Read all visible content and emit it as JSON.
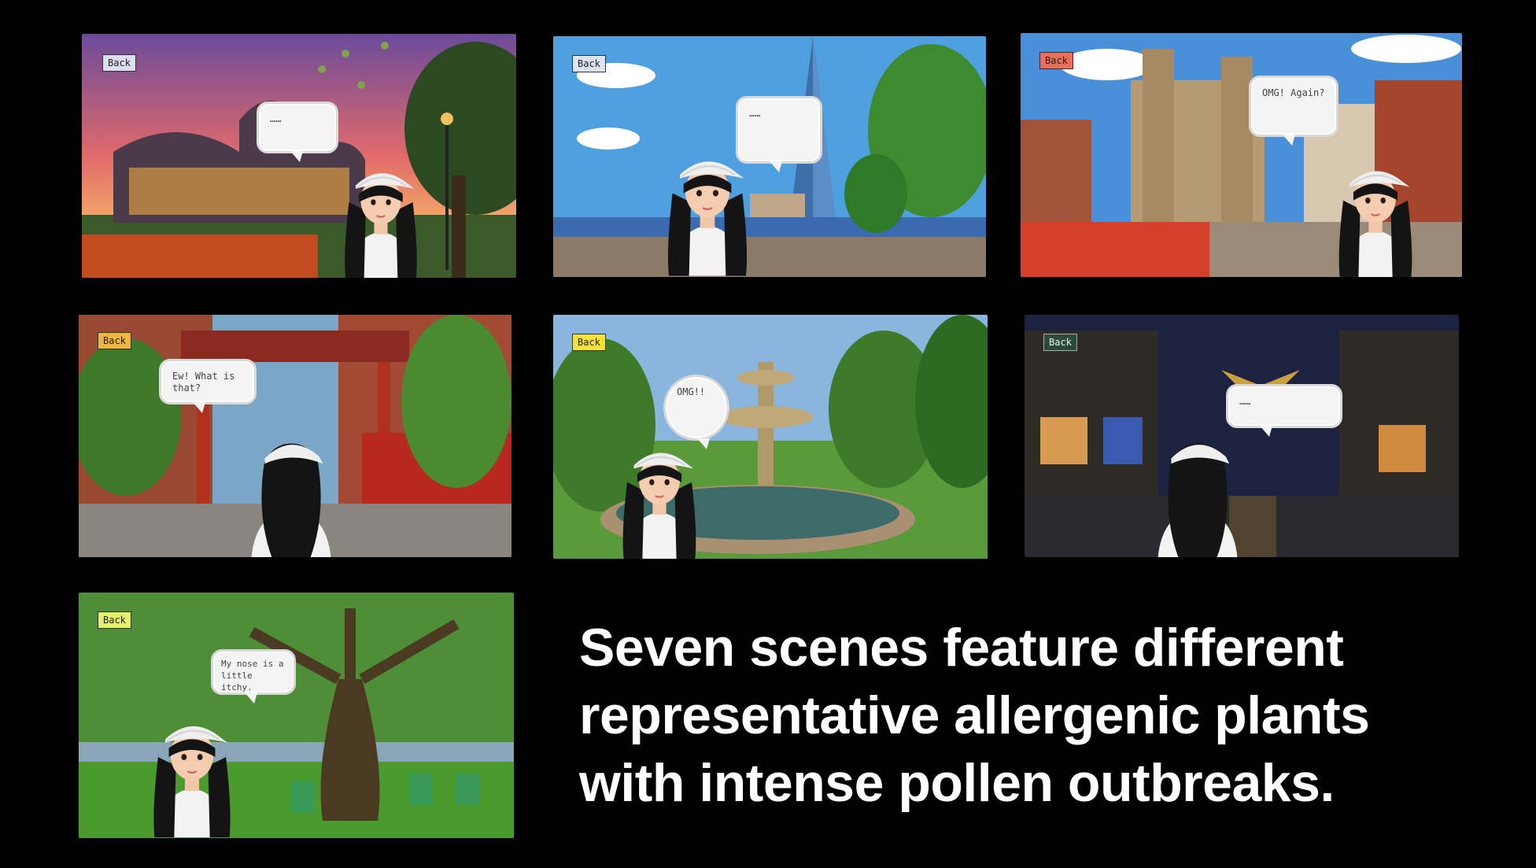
{
  "scenes": [
    {
      "back_label": "Back",
      "speech": "……"
    },
    {
      "back_label": "Back",
      "speech": "……"
    },
    {
      "back_label": "Back",
      "speech": "OMG! Again?"
    },
    {
      "back_label": "Back",
      "speech": "Ew! What is that?"
    },
    {
      "back_label": "Back",
      "speech": "OMG!!"
    },
    {
      "back_label": "Back",
      "speech": "……"
    },
    {
      "back_label": "Back",
      "speech": "My nose is a little itchy."
    }
  ],
  "headline": "Seven scenes feature different representative allergenic plants with intense pollen outbreaks.",
  "colors": {
    "background": "#000000",
    "headline": "#ffffff"
  }
}
